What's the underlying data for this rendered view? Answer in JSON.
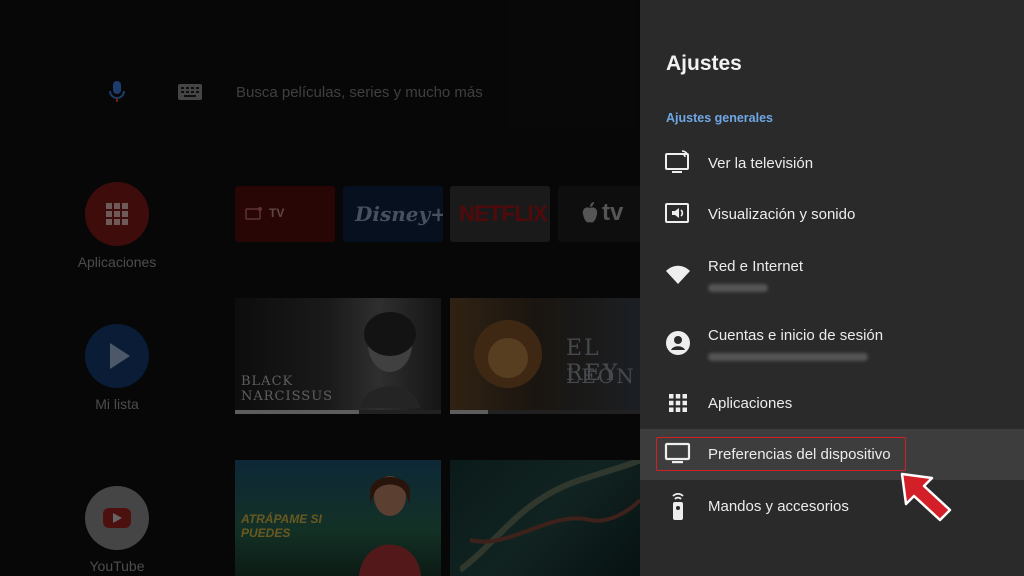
{
  "home": {
    "search": {
      "placeholder": "Busca películas, series y mucho más"
    },
    "sidebar": [
      {
        "label": "Aplicaciones",
        "icon": "apps-grid-icon",
        "color": "#b3261e"
      },
      {
        "label": "Mi lista",
        "icon": "play-icon",
        "color": "#1a73e8"
      },
      {
        "label": "YouTube",
        "icon": "youtube-icon",
        "color": "#ffffff"
      }
    ],
    "apps": [
      {
        "label": "TV"
      },
      {
        "label": "Disney+"
      },
      {
        "label": "NETFLIX"
      },
      {
        "label": "tv"
      }
    ],
    "movies": [
      {
        "title_line1": "BLACK",
        "title_line2": "NARCISSUS",
        "progress": 0.6
      },
      {
        "title_line1": "EL REY",
        "title_line2": "LEÓN",
        "progress": 0.2
      }
    ],
    "row3": [
      {
        "title": "ATRÁPAME SI PUEDES"
      },
      {
        "title": ""
      }
    ]
  },
  "settings": {
    "title": "Ajustes",
    "section": "Ajustes generales",
    "accent": "#6fa7e6",
    "items": [
      {
        "label": "Ver la televisión",
        "icon": "live-tv-icon"
      },
      {
        "label": "Visualización y sonido",
        "icon": "display-sound-icon"
      },
      {
        "label": "Red e Internet",
        "icon": "wifi-icon"
      },
      {
        "label": "Cuentas e inicio de sesión",
        "icon": "account-icon"
      },
      {
        "label": "Aplicaciones",
        "icon": "apps-grid-icon"
      },
      {
        "label": "Preferencias del dispositivo",
        "icon": "monitor-icon"
      },
      {
        "label": "Mandos y accesorios",
        "icon": "remote-icon"
      }
    ]
  },
  "annotation": {
    "highlight_color": "#d21f28"
  }
}
